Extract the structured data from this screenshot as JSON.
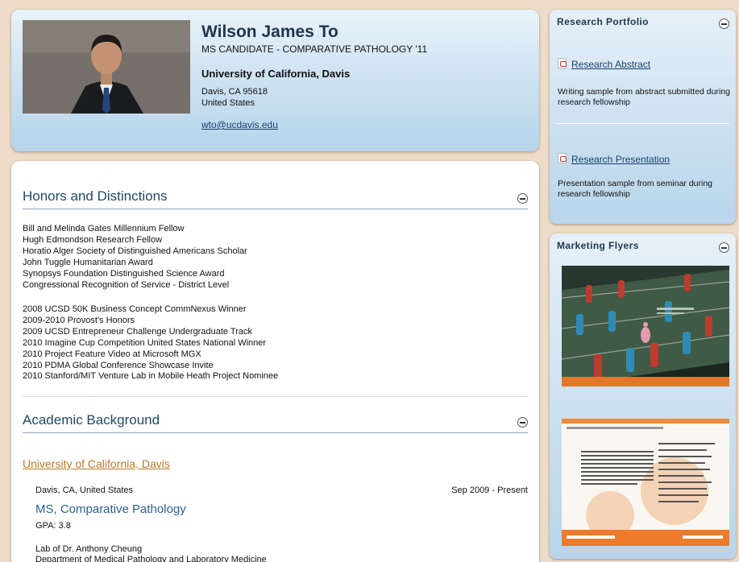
{
  "profile": {
    "name": "Wilson James To",
    "title": "MS CANDIDATE - COMPARATIVE PATHOLOGY '11",
    "university": "University of California, Davis",
    "city_state_zip": "Davis, CA 95618",
    "country": "United States",
    "email": "wto@ucdavis.edu"
  },
  "honors": {
    "heading": "Honors and Distinctions",
    "group1": [
      "Bill and Melinda Gates Millennium Fellow",
      "Hugh Edmondson Research Fellow",
      "Horatio Alger Society of Distinguished Americans Scholar",
      "John Tuggle Humanitarian Award",
      "Synopsys Foundation Distinguished Science Award",
      "Congressional Recognition of Service - District Level"
    ],
    "group2": [
      "2008 UCSD 50K Business Concept CommNexus Winner",
      "2009-2010 Provost's Honors",
      "2009 UCSD Entrepreneur Challenge Undergraduate Track",
      "2010 Imagine Cup Competition United States National Winner",
      "2010 Project Feature Video at Microsoft MGX",
      "2010 PDMA Global Conference Showcase Invite",
      "2010 Stanford/MIT Venture Lab in Mobile Heath Project Nominee"
    ]
  },
  "academic": {
    "heading": "Academic Background",
    "school": "University of California, Davis",
    "location": "Davis, CA, United States",
    "dates": "Sep 2009 - Present",
    "degree": "MS, Comparative Pathology",
    "gpa": "GPA: 3.8",
    "lab": "Lab of Dr. Anthony Cheung",
    "department": "Department of Medical Pathology and Laboratory Medicine"
  },
  "research_portfolio": {
    "heading": "Research Portfolio",
    "items": [
      {
        "label": "Research Abstract",
        "description": "Writing sample from abstract submitted during research fellowship"
      },
      {
        "label": "Research Presentation",
        "description": "Presentation sample from seminar during research fellowship"
      }
    ]
  },
  "marketing": {
    "heading": "Marketing Flyers"
  },
  "icons": {
    "collapse": "minus-circle-icon",
    "document": "pdf-icon"
  },
  "colors": {
    "accent_link": "#1c3f6e",
    "school_link": "#b87a25",
    "section_heading": "#1f4a66",
    "page_background": "#eddcc7",
    "panel_blue": "#c9dff0"
  }
}
